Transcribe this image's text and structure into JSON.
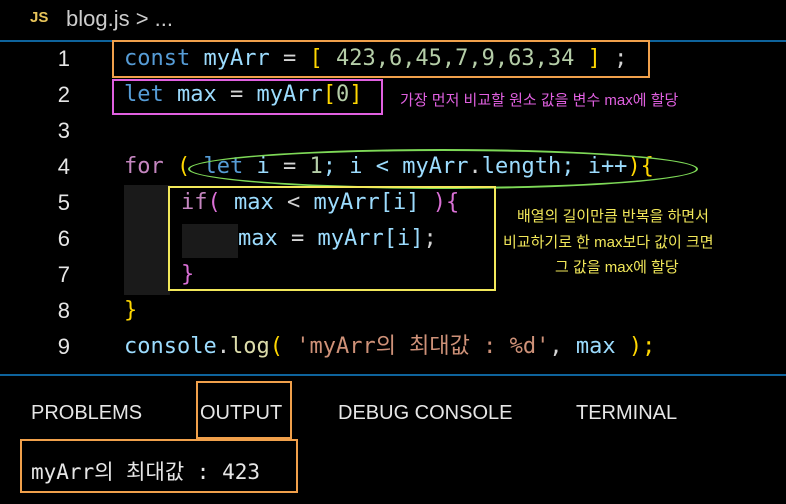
{
  "tab": {
    "icon": "JS",
    "filename": "blog.js",
    "breadcrumb": "> ..."
  },
  "lines": {
    "n1": "1",
    "n2": "2",
    "n3": "3",
    "n4": "4",
    "n5": "5",
    "n6": "6",
    "n7": "7",
    "n8": "8",
    "n9": "9",
    "l1": {
      "kw": "const",
      "name": "myArr",
      "eq": " = ",
      "open": "[",
      "vals": " 423,6,45,7,9,63,34 ",
      "close": "]",
      "end": " ;"
    },
    "l2": {
      "kw": "let",
      "name": "max",
      "eq": " = ",
      "arr": "myArr",
      "open": "[",
      "idx": "0",
      "close": "]"
    },
    "l4": {
      "kw": "for",
      "p1": " ( ",
      "let": "let",
      "i": " i",
      "eq": " = ",
      "one": "1",
      "semi": "; i < ",
      "arr": "myArr",
      "dot": ".",
      "len": "length",
      "rest": "; i++",
      "p2": "){"
    },
    "l5": {
      "kw": "if",
      "p1": "( ",
      "max": "max",
      "lt": " < ",
      "arr": "myArr",
      "idx": "[i]",
      "p2": " ){"
    },
    "l6": {
      "max": "max",
      "eq": " = ",
      "arr": "myArr",
      "idx": "[i]",
      "end": ";"
    },
    "l7": {
      "close": "}"
    },
    "l8": {
      "close": "}"
    },
    "l9": {
      "console": "console",
      "dot": ".",
      "log": "log",
      "p1": "( ",
      "str": "'myArr의 최대값 : %d'",
      "comma": ", ",
      "max": "max",
      "p2": " );"
    }
  },
  "annotations": {
    "line2_note": "가장 먼저 비교할 원소 값을 변수 max에 할당",
    "loop_note_1": "배열의 길이만큼 반복을 하면서",
    "loop_note_2": "비교하기로 한 max보다 값이 크면",
    "loop_note_3": "그 값을 max에 할당"
  },
  "panel": {
    "tabs": [
      "PROBLEMS",
      "OUTPUT",
      "DEBUG CONSOLE",
      "TERMINAL"
    ],
    "active_tab": "OUTPUT",
    "output": "myArr의 최대값 : 423"
  },
  "colors": {
    "orange_box": "#f0a04b",
    "magenta_box": "#e060e0",
    "green_box": "#7ed957",
    "yellow_box": "#f2e85a",
    "accent": "#0e639c"
  }
}
